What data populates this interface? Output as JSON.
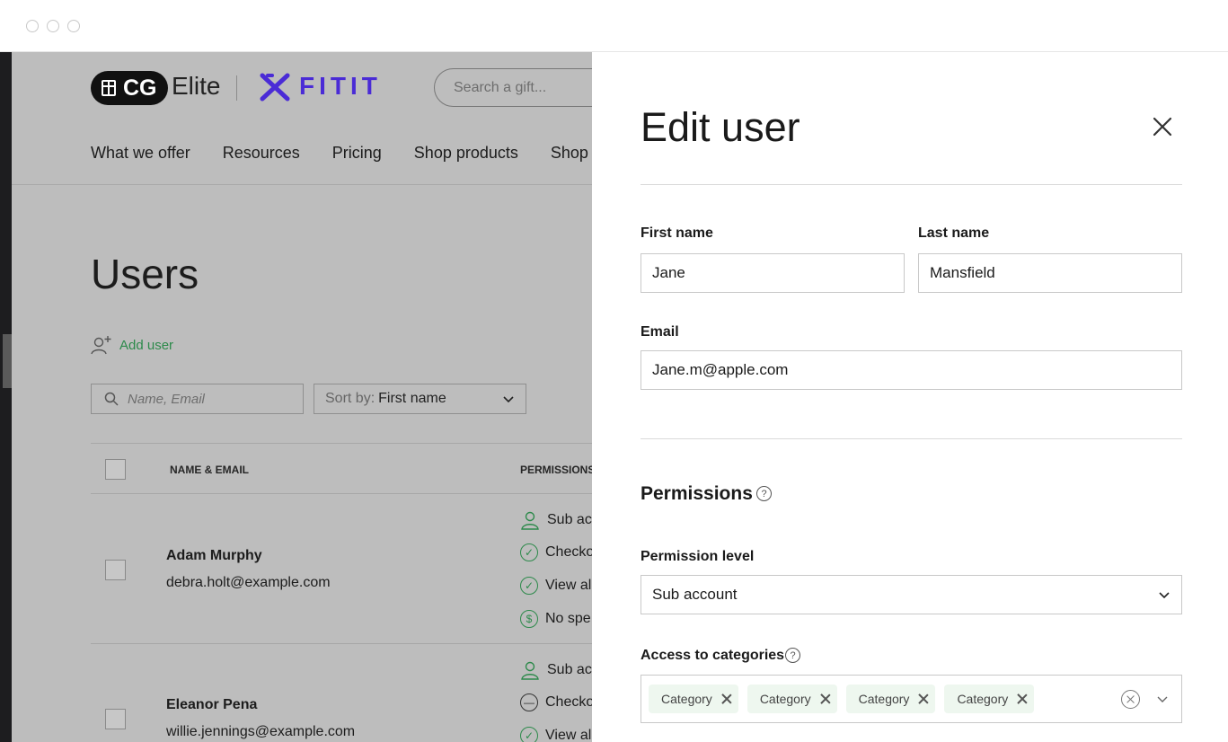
{
  "page": {
    "brand": {
      "cg": "CG",
      "elite": "Elite",
      "partner": "FITIT"
    },
    "search": {
      "placeholder": "Search a gift..."
    },
    "nav": [
      "What we offer",
      "Resources",
      "Pricing",
      "Shop products",
      "Shop by"
    ],
    "title": "Users",
    "add_user": "Add user",
    "filter": {
      "placeholder": "Name, Email"
    },
    "sort": {
      "prefix": "Sort by:",
      "value": "First name"
    },
    "table": {
      "headers": {
        "name_email": "NAME & EMAIL",
        "permissions": "PERMISSIONS"
      },
      "rows": [
        {
          "name": "Adam Murphy",
          "email": "debra.holt@example.com",
          "perms": [
            "Sub acc",
            "Checko",
            "View al",
            "No spe"
          ]
        },
        {
          "name": "Eleanor Pena",
          "email": "willie.jennings@example.com",
          "perms": [
            "Sub acc",
            "Checko",
            "View al"
          ]
        }
      ]
    }
  },
  "drawer": {
    "title": "Edit user",
    "first_name": {
      "label": "First name",
      "value": "Jane"
    },
    "last_name": {
      "label": "Last name",
      "value": "Mansfield"
    },
    "email": {
      "label": "Email",
      "value": "Jane.m@apple.com"
    },
    "permissions_heading": "Permissions",
    "permission_level": {
      "label": "Permission level",
      "value": "Sub account"
    },
    "categories": {
      "label": "Access to categories",
      "chips": [
        "Category",
        "Category",
        "Category",
        "Category"
      ]
    }
  },
  "colors": {
    "accent_green": "#2d8a4b",
    "brand_purple": "#4a2bd6",
    "overlay": "#bdbdbd"
  },
  "icons": {
    "close": "close-icon",
    "help": "help-circle-icon",
    "chevron": "chevron-down-icon",
    "search": "search-icon",
    "add_user": "add-user-icon",
    "clear": "clear-circle-icon"
  }
}
